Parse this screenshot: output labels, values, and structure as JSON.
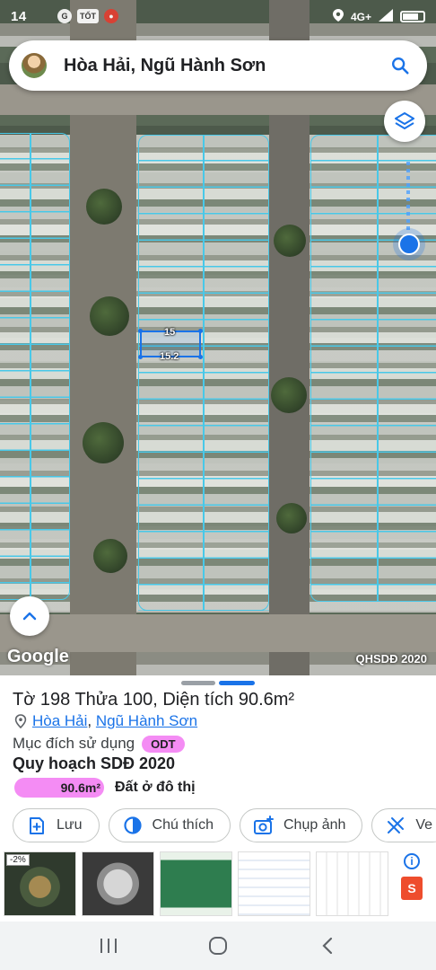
{
  "status_bar": {
    "time": "14",
    "carrier_badge": "TỐT",
    "network": "4G+"
  },
  "search": {
    "title": "Hòa Hải, Ngũ Hành Sơn",
    "search_icon": "search-icon",
    "avatar_icon": "avatar"
  },
  "map": {
    "google_label": "Google",
    "layer_label": "QHSDĐ 2020",
    "measure_top": "15",
    "measure_bottom": "15.2",
    "parcel_line_color": "#48c8e8",
    "selection_color": "#1a73e8",
    "location_color": "#1a73e8"
  },
  "parcel": {
    "title": "Tờ 198 Thửa 100, Diện tích 90.6m²",
    "ward": "Hòa Hải",
    "separator": ",",
    "district": "Ngũ Hành Sơn",
    "usage_label": "Mục đích sử dụng",
    "usage_code": "ODT",
    "plan_title": "Quy hoạch SDĐ 2020",
    "plan_area": "90.6m²",
    "plan_area_fraction": 1.0,
    "plan_name": "Đất ở đô thị",
    "badge_color": "#f48cf4"
  },
  "actions": [
    {
      "label": "Lưu",
      "icon": "add-bookmark-icon"
    },
    {
      "label": "Chú thích",
      "icon": "legend-icon"
    },
    {
      "label": "Chụp ảnh",
      "icon": "add-photo-icon"
    },
    {
      "label": "Ve",
      "icon": "measure-icon"
    }
  ],
  "ads": {
    "discount_badge": "-2%",
    "info_icon": "i",
    "shop_icon": "S"
  }
}
